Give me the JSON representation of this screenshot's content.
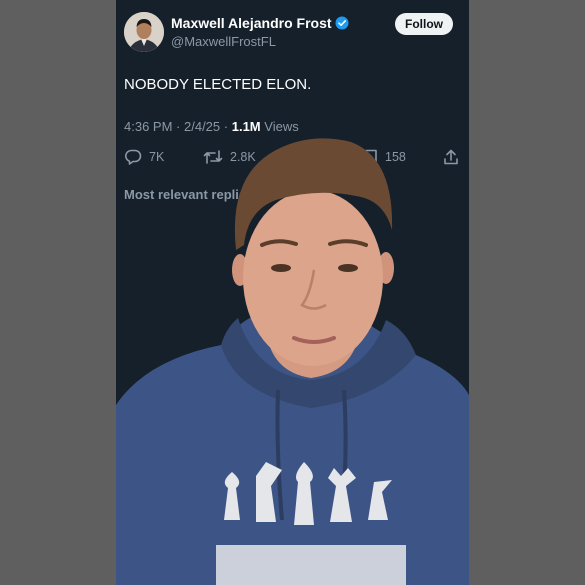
{
  "tweet": {
    "author_name": "Maxwell Alejandro Frost",
    "handle": "@MaxwellFrostFL",
    "follow_label": "Follow",
    "text": "NOBODY ELECTED ELON.",
    "time": "4:36 PM",
    "date": "2/4/25",
    "views_count": "1.1M",
    "views_label": "Views",
    "replies": "7K",
    "retweets": "2.8K",
    "bookmarks": "158",
    "replies_header": "Most relevant replies"
  },
  "colors": {
    "background": "#15202b",
    "text": "#ffffff",
    "muted": "#8b98a5",
    "verified": "#1d9bf0",
    "follow_bg": "#eff3f4"
  },
  "icons": [
    "reply-icon",
    "retweet-icon",
    "bookmark-icon",
    "share-icon",
    "verified-badge-icon"
  ]
}
